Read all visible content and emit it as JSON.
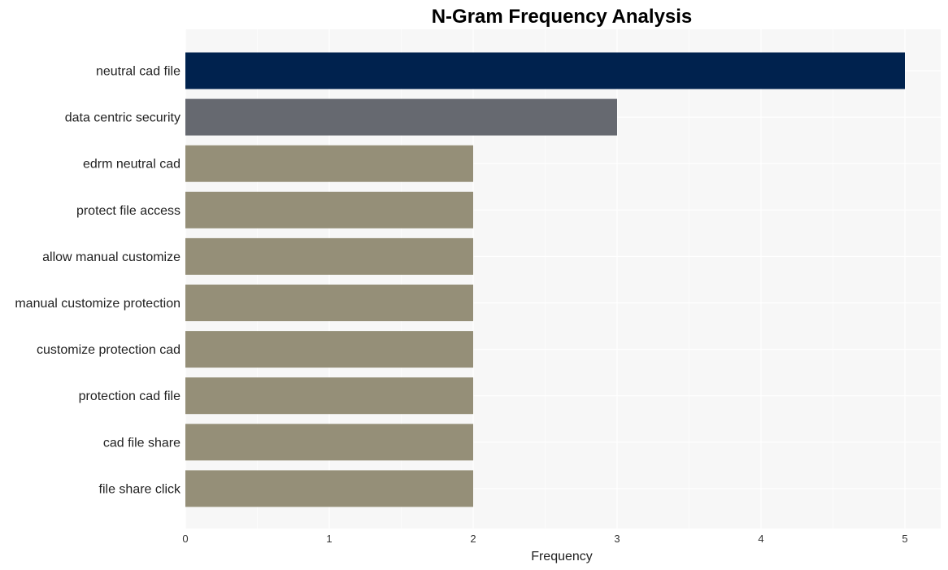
{
  "chart_data": {
    "type": "bar",
    "orientation": "horizontal",
    "title": "N-Gram Frequency Analysis",
    "xlabel": "Frequency",
    "ylabel": "",
    "xlim": [
      0,
      5.25
    ],
    "xticks": [
      0,
      1,
      2,
      3,
      4,
      5
    ],
    "grid": true,
    "categories": [
      "neutral cad file",
      "data centric security",
      "edrm neutral cad",
      "protect file access",
      "allow manual customize",
      "manual customize protection",
      "customize protection cad",
      "protection cad file",
      "cad file share",
      "file share click"
    ],
    "values": [
      5,
      3,
      2,
      2,
      2,
      2,
      2,
      2,
      2,
      2
    ],
    "bar_colors": [
      "#00224e",
      "#666970",
      "#958f78",
      "#958f78",
      "#958f78",
      "#958f78",
      "#958f78",
      "#958f78",
      "#958f78",
      "#958f78"
    ],
    "panel_background": "#f7f7f7",
    "gridline_color": "#ffffff"
  }
}
